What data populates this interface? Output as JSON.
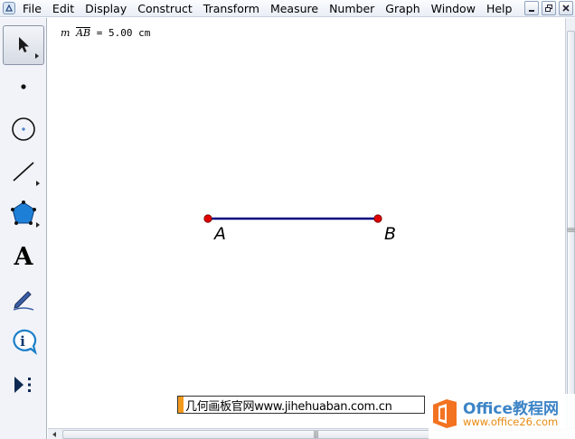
{
  "menubar": {
    "items": [
      "File",
      "Edit",
      "Display",
      "Construct",
      "Transform",
      "Measure",
      "Number",
      "Graph",
      "Window",
      "Help"
    ]
  },
  "window_controls": [
    "minimize-icon",
    "restore-icon",
    "close-icon"
  ],
  "toolbox": {
    "tools": [
      {
        "name": "arrow-tool",
        "icon": "arrow-cursor-icon",
        "selected": true
      },
      {
        "name": "point-tool",
        "icon": "point-icon"
      },
      {
        "name": "compass-tool",
        "icon": "circle-icon"
      },
      {
        "name": "straightedge-tool",
        "icon": "line-segment-icon"
      },
      {
        "name": "polygon-tool",
        "icon": "pentagon-icon"
      },
      {
        "name": "text-tool",
        "icon": "text-a-icon",
        "glyph": "A"
      },
      {
        "name": "marker-tool",
        "icon": "pen-icon"
      },
      {
        "name": "information-tool",
        "icon": "info-icon"
      },
      {
        "name": "custom-tool",
        "icon": "play-more-icon"
      }
    ]
  },
  "canvas": {
    "measurement": {
      "prefix": "m",
      "segment": "AB",
      "value": "= 5.00 cm"
    },
    "points": [
      {
        "label": "A",
        "color": "#e00000"
      },
      {
        "label": "B",
        "color": "#e00000"
      }
    ],
    "segment_color": "#000080"
  },
  "watermark": {
    "site_text": "几何画板官网www.jihehuaban.com.cn",
    "logo_title": "Office教程网",
    "logo_url": "www.office26.com",
    "logo_colors": {
      "orange": "#f37321",
      "blue": "#3d84c6"
    }
  }
}
